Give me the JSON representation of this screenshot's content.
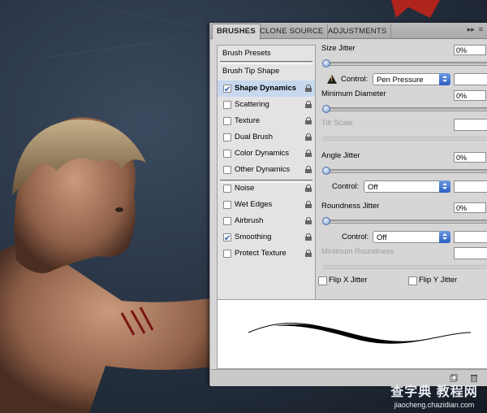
{
  "tabs": [
    {
      "label": "BRUSHES",
      "active": true
    },
    {
      "label": "CLONE SOURCE",
      "active": false
    },
    {
      "label": "ADJUSTMENTS",
      "active": false
    }
  ],
  "tab_menu_icon": "panel-menu-icon",
  "left_list": {
    "brush_presets": "Brush Presets",
    "brush_tip_shape": "Brush Tip Shape",
    "items": [
      {
        "label": "Shape Dynamics",
        "checked": true,
        "selected": true
      },
      {
        "label": "Scattering",
        "checked": false
      },
      {
        "label": "Texture",
        "checked": false
      },
      {
        "label": "Dual Brush",
        "checked": false
      },
      {
        "label": "Color Dynamics",
        "checked": false
      },
      {
        "label": "Other Dynamics",
        "checked": false
      },
      {
        "label": "Noise",
        "checked": false
      },
      {
        "label": "Wet Edges",
        "checked": false
      },
      {
        "label": "Airbrush",
        "checked": false
      },
      {
        "label": "Smoothing",
        "checked": true
      },
      {
        "label": "Protect Texture",
        "checked": false
      }
    ]
  },
  "settings": {
    "size_jitter": {
      "label": "Size Jitter",
      "value": "0%"
    },
    "control1": {
      "label": "Control:",
      "value": "Pen Pressure"
    },
    "minimum_diameter": {
      "label": "Minimum Diameter",
      "value": "0%"
    },
    "tilt_scale": {
      "label": "Tilt Scale"
    },
    "angle_jitter": {
      "label": "Angle Jitter",
      "value": "0%"
    },
    "control2": {
      "label": "Control:",
      "value": "Off"
    },
    "roundness_jitter": {
      "label": "Roundness Jitter",
      "value": "0%"
    },
    "control3": {
      "label": "Control:",
      "value": "Off"
    },
    "minimum_roundness": {
      "label": "Minimum Roundness"
    },
    "flip_x": {
      "label": "Flip X Jitter",
      "checked": false
    },
    "flip_y": {
      "label": "Flip Y Jitter",
      "checked": false
    }
  },
  "watermark": {
    "line1": "查字典 教程网",
    "line2": "jiaocheng.chazidian.com"
  }
}
